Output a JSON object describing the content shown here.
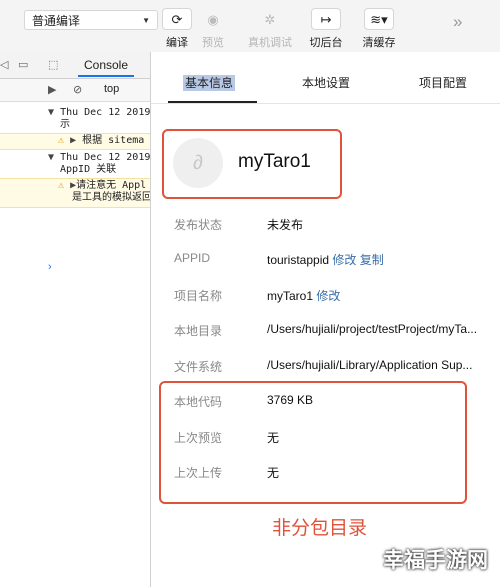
{
  "toolbar": {
    "mode_select": "普通编译",
    "buttons": [
      {
        "label": "编译",
        "icon": "refresh-icon",
        "glyph": "⟳",
        "disabled": false
      },
      {
        "label": "预览",
        "icon": "eye-icon",
        "glyph": "◉",
        "disabled": true
      },
      {
        "label": "真机调试",
        "icon": "bug-icon",
        "glyph": "✲",
        "disabled": true
      },
      {
        "label": "切后台",
        "icon": "switch-background-icon",
        "glyph": "↦",
        "disabled": false
      },
      {
        "label": "清缓存",
        "icon": "layers-icon",
        "glyph": "≋▾",
        "disabled": false
      }
    ],
    "more_glyph": "»"
  },
  "devtools": {
    "tab_console": "Console",
    "context": "top",
    "logs": [
      {
        "line1": "Thu Dec 12 2019",
        "line2": "示"
      },
      {
        "warn": "根据 sitema"
      },
      {
        "line1": "Thu Dec 12 2019",
        "line2": "AppID 关联"
      },
      {
        "warn": "请注意无 Appl",
        "warn2": "是工具的模拟返回"
      }
    ]
  },
  "panel": {
    "tabs": [
      "基本信息",
      "本地设置",
      "项目配置"
    ],
    "project_name": "myTaro1",
    "rows": [
      {
        "key": "发布状态",
        "value": "未发布"
      },
      {
        "key": "APPID",
        "value": "touristappid",
        "links": [
          "修改",
          "复制"
        ]
      },
      {
        "key": "项目名称",
        "value": "myTaro1",
        "links": [
          "修改"
        ]
      },
      {
        "key": "本地目录",
        "value": "/Users/hujiali/project/testProject/myTa..."
      },
      {
        "key": "文件系统",
        "value": "/Users/hujiali/Library/Application Sup..."
      },
      {
        "key": "本地代码",
        "value": "3769 KB"
      },
      {
        "key": "上次预览",
        "value": "无"
      },
      {
        "key": "上次上传",
        "value": "无"
      }
    ],
    "annotation": "非分包目录"
  },
  "watermark": "幸福手游网",
  "colors": {
    "highlight": "#e0533b",
    "link": "#3a6ea8",
    "tab_selection": "#b8c9e6"
  }
}
